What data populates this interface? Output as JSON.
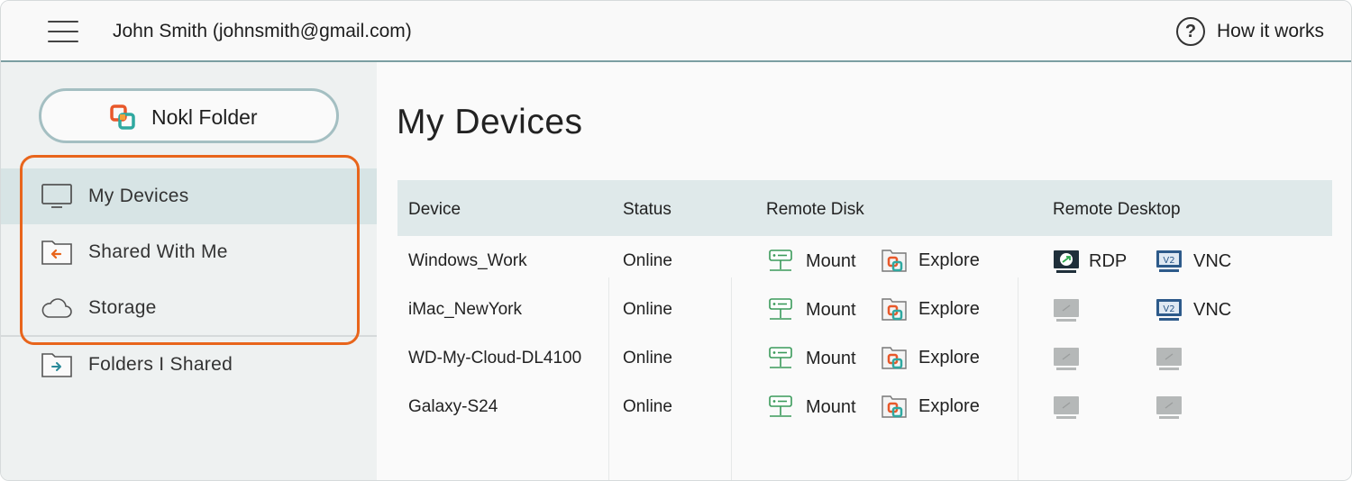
{
  "header": {
    "user": "John Smith (johnsmith@gmail.com)",
    "help_icon": "help-circle-icon",
    "help_label": "How it works"
  },
  "sidebar": {
    "nokl_button": {
      "label": "Nokl Folder",
      "icon": "nokl-logo-icon"
    },
    "items": [
      {
        "label": "My Devices",
        "icon": "monitor-icon",
        "active": true
      },
      {
        "label": "Shared With Me",
        "icon": "folder-incoming-icon"
      },
      {
        "label": "Storage",
        "icon": "cloud-icon"
      },
      {
        "label": "Folders I Shared",
        "icon": "folder-outgoing-icon"
      }
    ],
    "highlight_color": "#e8651c"
  },
  "main": {
    "title": "My Devices",
    "columns": [
      "Device",
      "Status",
      "Remote Disk",
      "Remote Desktop"
    ],
    "actions": {
      "mount": "Mount",
      "explore": "Explore",
      "rdp": "RDP",
      "vnc": "VNC"
    },
    "rows": [
      {
        "device": "Windows_Work",
        "status": "Online",
        "rdp": true,
        "vnc": true
      },
      {
        "device": "iMac_NewYork",
        "status": "Online",
        "rdp": false,
        "vnc": true
      },
      {
        "device": "WD-My-Cloud-DL4100",
        "status": "Online",
        "rdp": false,
        "vnc": false
      },
      {
        "device": "Galaxy-S24",
        "status": "Online",
        "rdp": false,
        "vnc": false
      }
    ]
  },
  "colors": {
    "accent_border": "#7b9ea2",
    "active_nav": "#d7e4e5",
    "table_header": "#dfe9ea",
    "highlight": "#e8651c"
  }
}
